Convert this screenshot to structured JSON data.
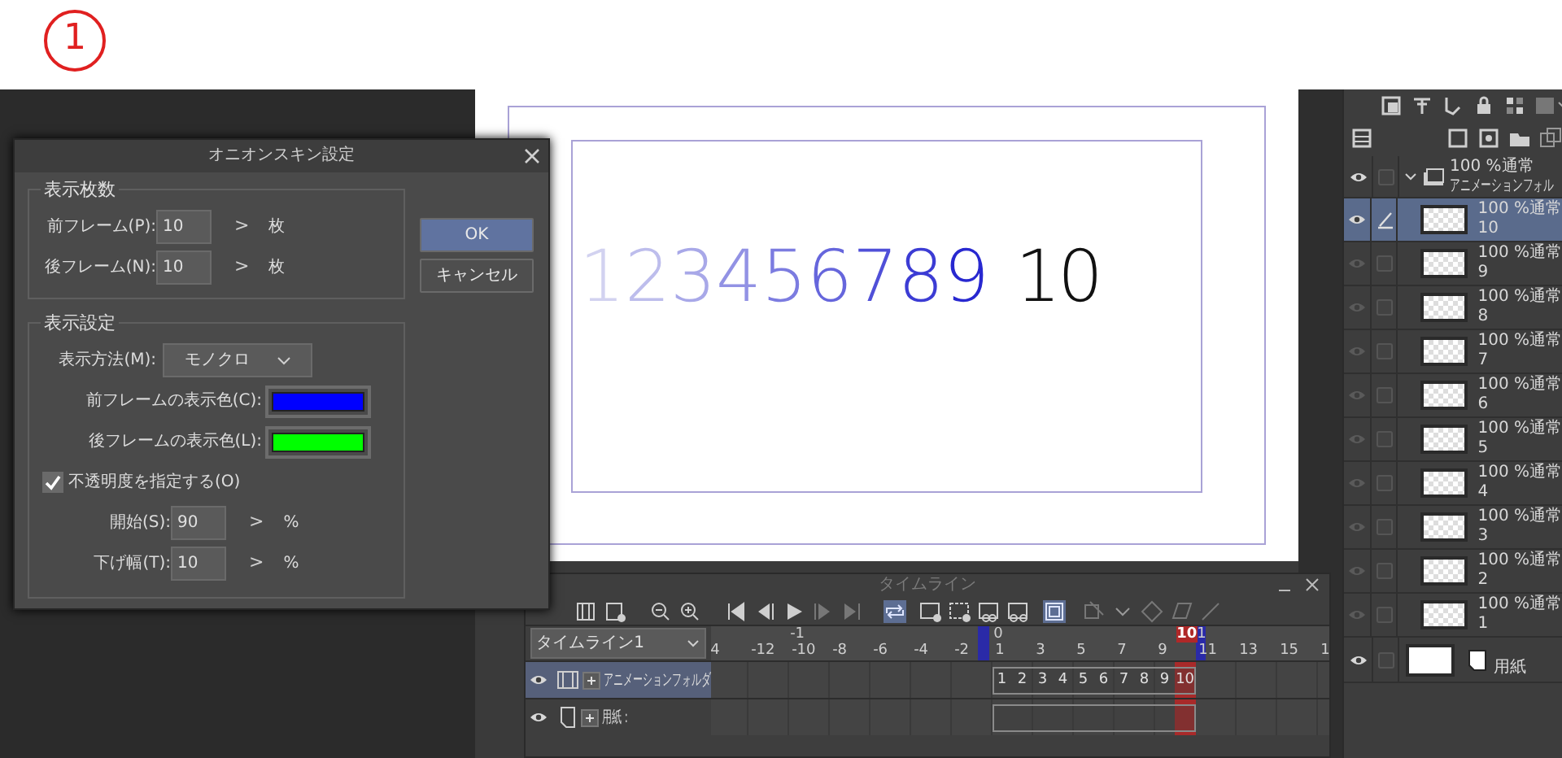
{
  "annotation": {
    "text": "1"
  },
  "canvas": {
    "frames": [
      {
        "text": "1",
        "color": "#d2d2f0"
      },
      {
        "text": "2",
        "color": "#bdbdec"
      },
      {
        "text": "3",
        "color": "#a8a8e8"
      },
      {
        "text": "4",
        "color": "#9292e4"
      },
      {
        "text": "5",
        "color": "#7c7ce0"
      },
      {
        "text": "6",
        "color": "#6666dc"
      },
      {
        "text": "7",
        "color": "#5050d8"
      },
      {
        "text": "8",
        "color": "#3c3cd4"
      },
      {
        "text": "9",
        "color": "#2828d0"
      },
      {
        "text": "10",
        "color": "#111111"
      }
    ]
  },
  "onion_dialog": {
    "title": "オニオンスキン設定",
    "count_group": {
      "title": "表示枚数",
      "rows": [
        {
          "label": "前フレーム(P):",
          "value": "10",
          "arrow": ">",
          "unit": "枚"
        },
        {
          "label": "後フレーム(N):",
          "value": "10",
          "arrow": ">",
          "unit": "枚"
        }
      ]
    },
    "display_group": {
      "title": "表示設定",
      "method": {
        "label": "表示方法(M):",
        "value": "モノクロ"
      },
      "colors": [
        {
          "label": "前フレームの表示色(C):",
          "color": "#0000ff"
        },
        {
          "label": "後フレームの表示色(L):",
          "color": "#00ff00"
        }
      ],
      "opacity": {
        "label": "不透明度を指定する(O)",
        "checked": true
      },
      "rows": [
        {
          "label": "開始(S):",
          "value": "90",
          "arrow": ">",
          "unit": "%"
        },
        {
          "label": "下げ幅(T):",
          "value": "10",
          "arrow": ">",
          "unit": "%"
        }
      ]
    },
    "buttons": [
      {
        "label": "OK",
        "primary": true
      },
      {
        "label": "キャンセル",
        "primary": false
      }
    ]
  },
  "timeline": {
    "title": "タイムライン",
    "selector": "タイムライン1",
    "ruler_ticks": [
      {
        "label": "4"
      },
      {
        "label": "-12"
      },
      {
        "label": "-10"
      },
      {
        "label": "-8"
      },
      {
        "label": "-6"
      },
      {
        "label": "-4"
      },
      {
        "label": "-2"
      },
      {
        "label": "1"
      },
      {
        "label": "3"
      },
      {
        "label": "5"
      },
      {
        "label": "7"
      },
      {
        "label": "9"
      },
      {
        "label": "11"
      },
      {
        "label": "13"
      },
      {
        "label": "15"
      },
      {
        "label": "1"
      }
    ],
    "ruler_top": [
      {
        "label": "-1",
        "kind": "plain"
      },
      {
        "label": "0",
        "kind": "plain"
      },
      {
        "label": "10",
        "kind": "current"
      },
      {
        "label": "1",
        "kind": "marker"
      }
    ],
    "tracks": [
      {
        "kind": "folder",
        "name": "アニメーションフォルダ",
        "selected": true,
        "cells": [
          "1",
          "2",
          "3",
          "4",
          "5",
          "6",
          "7",
          "8",
          "9",
          "10"
        ]
      },
      {
        "kind": "paper",
        "name": "用紙 :",
        "selected": false
      }
    ]
  },
  "layers": [
    {
      "kind": "folder",
      "mode": "100 %通常",
      "name": "アニメーションフォル",
      "visible": true,
      "selected": false
    },
    {
      "kind": "layer",
      "mode": "100 %通常",
      "name": "10",
      "visible": true,
      "selected": true
    },
    {
      "kind": "layer",
      "mode": "100 %通常",
      "name": "9",
      "visible": false,
      "selected": false
    },
    {
      "kind": "layer",
      "mode": "100 %通常",
      "name": "8",
      "visible": false,
      "selected": false
    },
    {
      "kind": "layer",
      "mode": "100 %通常",
      "name": "7",
      "visible": false,
      "selected": false
    },
    {
      "kind": "layer",
      "mode": "100 %通常",
      "name": "6",
      "visible": false,
      "selected": false
    },
    {
      "kind": "layer",
      "mode": "100 %通常",
      "name": "5",
      "visible": false,
      "selected": false
    },
    {
      "kind": "layer",
      "mode": "100 %通常",
      "name": "4",
      "visible": false,
      "selected": false
    },
    {
      "kind": "layer",
      "mode": "100 %通常",
      "name": "3",
      "visible": false,
      "selected": false
    },
    {
      "kind": "layer",
      "mode": "100 %通常",
      "name": "2",
      "visible": false,
      "selected": false
    },
    {
      "kind": "layer",
      "mode": "100 %通常",
      "name": "1",
      "visible": false,
      "selected": false
    },
    {
      "kind": "paper",
      "name": "用紙",
      "visible": true,
      "selected": false
    }
  ]
}
